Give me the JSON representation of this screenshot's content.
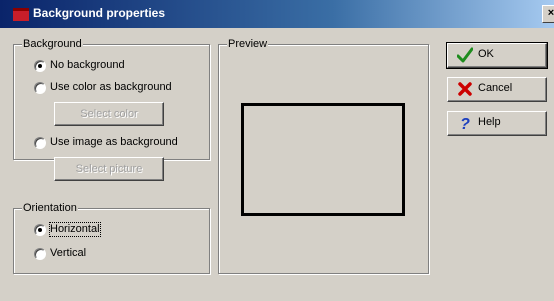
{
  "window": {
    "title": "Background properties",
    "close_glyph": "×"
  },
  "background_group": {
    "legend": "Background",
    "options": [
      {
        "label": "No background",
        "checked": true
      },
      {
        "label": "Use color as background",
        "checked": false
      },
      {
        "label": "Use image as background",
        "checked": false
      }
    ],
    "select_color_label": "Select color",
    "select_picture_label": "Select picture"
  },
  "orientation_group": {
    "legend": "Orientation",
    "options": [
      {
        "label": "Horizontal",
        "checked": true
      },
      {
        "label": "Vertical",
        "checked": false
      }
    ]
  },
  "preview": {
    "legend": "Preview"
  },
  "buttons": {
    "ok_label": "OK",
    "cancel_label": "Cancel",
    "help_label": "Help"
  },
  "colors": {
    "dialog_bg": "#d4d0c8",
    "title_gradient_start": "#0a246a",
    "ok_check": "#1e8c1e",
    "cancel_x": "#cc0000",
    "help_question": "#1c3fbf"
  }
}
